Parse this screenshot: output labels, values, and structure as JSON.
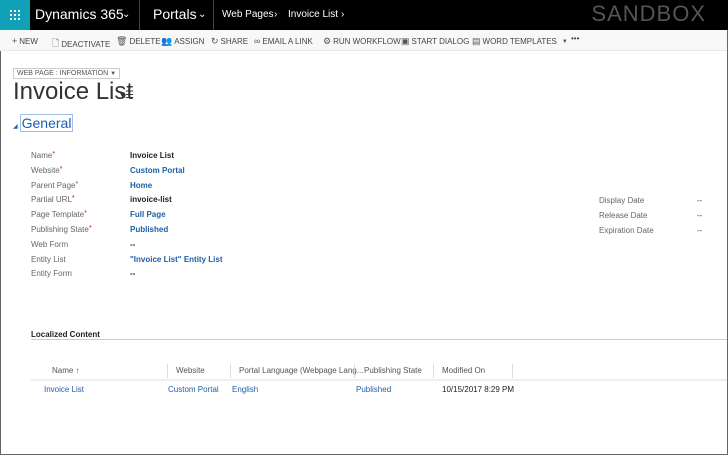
{
  "nav": {
    "app": "Dynamics 365",
    "area": "Portals",
    "breadcrumb": [
      "Web Pages",
      "Invoice List"
    ],
    "environment": "SANDBOX"
  },
  "toolbar": [
    {
      "label": "NEW",
      "icon": "plus-icon"
    },
    {
      "label": "DEACTIVATE",
      "icon": "deactivate-icon"
    },
    {
      "label": "DELETE",
      "icon": "trash-icon"
    },
    {
      "label": "ASSIGN",
      "icon": "assign-icon"
    },
    {
      "label": "SHARE",
      "icon": "share-icon"
    },
    {
      "label": "EMAIL A LINK",
      "icon": "link-icon"
    },
    {
      "label": "RUN WORKFLOW",
      "icon": "workflow-icon"
    },
    {
      "label": "START DIALOG",
      "icon": "dialog-icon"
    },
    {
      "label": "WORD TEMPLATES",
      "icon": "word-icon"
    },
    {
      "label": "•••",
      "icon": "more-icon"
    }
  ],
  "form": {
    "selector": "WEB PAGE : INFORMATION",
    "title": "Invoice List",
    "section": "General"
  },
  "fields": [
    {
      "label": "Name",
      "value": "Invoice List",
      "marker": "required",
      "link": false
    },
    {
      "label": "Website",
      "value": "Custom Portal",
      "marker": "required",
      "link": true
    },
    {
      "label": "Parent Page",
      "value": "Home",
      "marker": "recommended",
      "link": true
    },
    {
      "label": "Partial URL",
      "value": "invoice-list",
      "marker": "required",
      "link": false
    },
    {
      "label": "Page Template",
      "value": "Full Page",
      "marker": "required",
      "link": true
    },
    {
      "label": "Publishing State",
      "value": "Published",
      "marker": "required",
      "link": true
    },
    {
      "label": "Web Form",
      "value": "--",
      "marker": "",
      "link": false
    },
    {
      "label": "Entity List",
      "value": "\"Invoice List\" Entity List",
      "marker": "",
      "link": true
    },
    {
      "label": "Entity Form",
      "value": "--",
      "marker": "",
      "link": false
    }
  ],
  "dates": [
    {
      "label": "Display Date",
      "value": "--"
    },
    {
      "label": "Release Date",
      "value": "--"
    },
    {
      "label": "Expiration Date",
      "value": "--"
    }
  ],
  "localized": {
    "title": "Localized Content",
    "columns": [
      "Name ↑",
      "Website",
      "Portal Language (Webpage Lang...",
      "Publishing State",
      "Modified On"
    ],
    "rows": [
      [
        "Invoice List",
        "Custom Portal",
        "English",
        "Published",
        "10/15/2017 8:29 PM"
      ]
    ]
  },
  "colors": {
    "tile": "#10a0b8",
    "link": "#1f5ea8",
    "required": "#dd0000"
  }
}
